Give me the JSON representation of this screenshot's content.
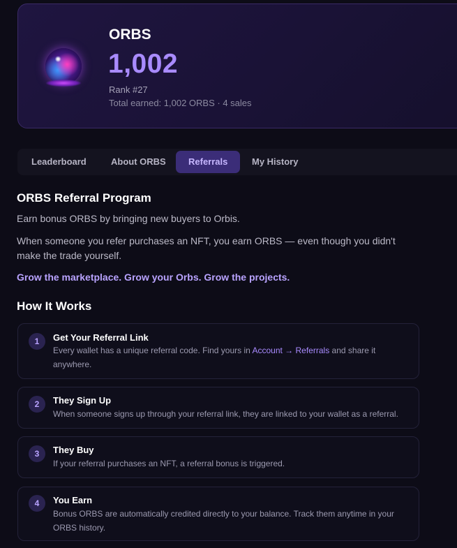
{
  "hero": {
    "title": "ORBS",
    "value": "1,002",
    "rank": "Rank #27",
    "total_earned": "Total earned: 1,002 ORBS · 4 sales",
    "icon": "crystal-orb-icon"
  },
  "tabs": [
    {
      "label": "Leaderboard",
      "active": false
    },
    {
      "label": "About ORBS",
      "active": false
    },
    {
      "label": "Referrals",
      "active": true
    },
    {
      "label": "My History",
      "active": false
    }
  ],
  "content": {
    "heading": "ORBS Referral Program",
    "intro": "Earn bonus ORBS by bringing new buyers to Orbis.",
    "description": "When someone you refer purchases an NFT, you earn ORBS — even though you didn't make the trade yourself.",
    "tagline": "Grow the marketplace. Grow your Orbs. Grow the projects.",
    "how_heading": "How It Works"
  },
  "steps": [
    {
      "number": "1",
      "title": "Get Your Referral Link",
      "desc_before": "Every wallet has a unique referral code. Find yours in ",
      "link": "Account → Referrals",
      "desc_after": " and share it anywhere."
    },
    {
      "number": "2",
      "title": "They Sign Up",
      "desc": "When someone signs up through your referral link, they are linked to your wallet as a referral."
    },
    {
      "number": "3",
      "title": "They Buy",
      "desc": "If your referral purchases an NFT, a referral bonus is triggered."
    },
    {
      "number": "4",
      "title": "You Earn",
      "desc": "Bonus ORBS are automatically credited directly to your balance. Track them anytime in your ORBS history."
    }
  ],
  "colors": {
    "background": "#0d0c17",
    "accent": "#a98bff",
    "active_tab": "#3b2d78",
    "card_border": "#24223a"
  }
}
